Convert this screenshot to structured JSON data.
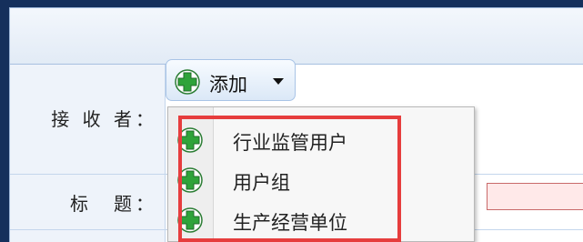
{
  "form": {
    "receiver_label": "接 收 者：",
    "title_label": "标　题："
  },
  "add_button": {
    "label": "添加"
  },
  "dropdown": {
    "items": [
      {
        "label": "行业监管用户",
        "icon": "green-plus-icon"
      },
      {
        "label": "用户组",
        "icon": "green-plus-icon"
      },
      {
        "label": "生产经营单位",
        "icon": "green-plus-icon"
      }
    ]
  },
  "colors": {
    "highlight": "#e63d3d",
    "icon_green": "#2fa33a",
    "title_input_border": "#c96a6a"
  }
}
